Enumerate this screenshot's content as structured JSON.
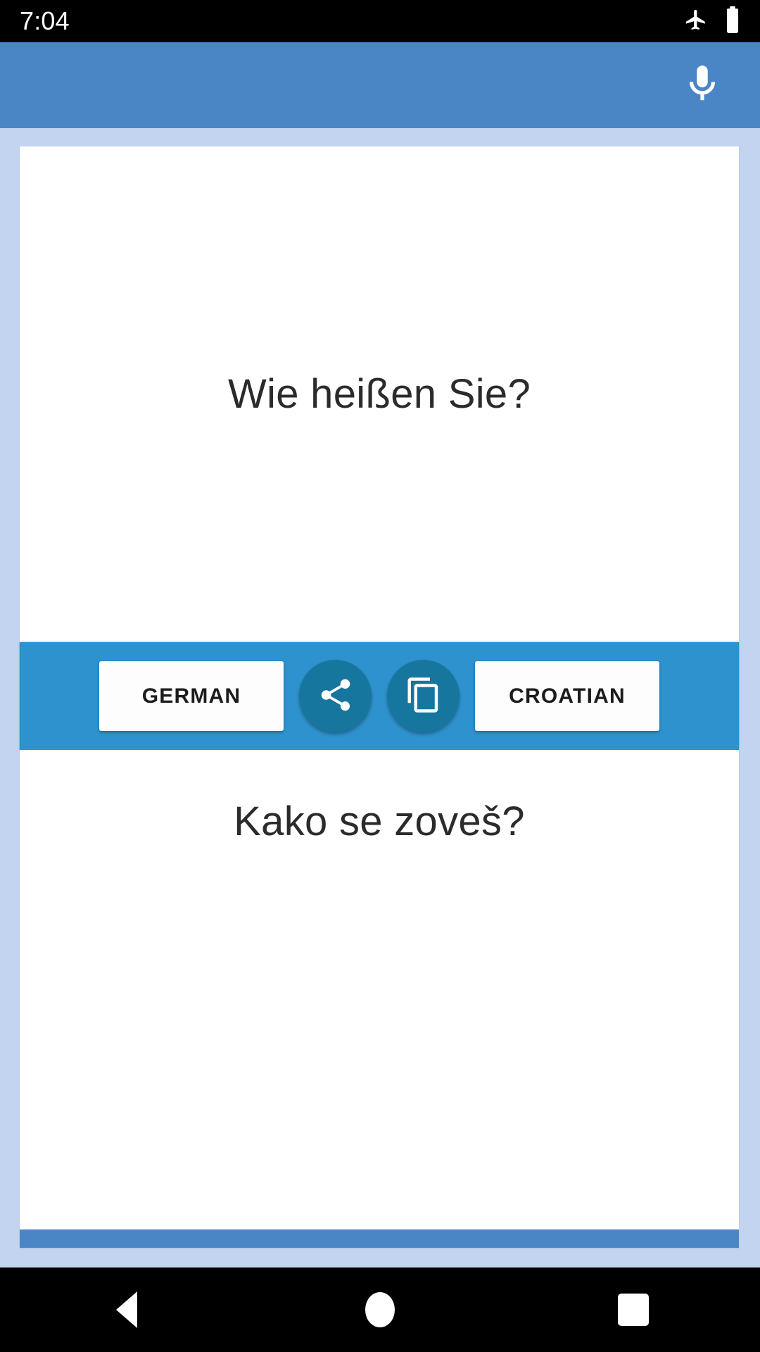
{
  "status_bar": {
    "clock": "7:04",
    "icons": [
      "airplane-mode-icon",
      "battery-icon"
    ]
  },
  "app_bar": {
    "mic_icon": "microphone-icon",
    "background_color": "#4a85c6"
  },
  "translator": {
    "source": {
      "text": "Wie heißen Sie?",
      "language_label": "GERMAN"
    },
    "target": {
      "text": "Kako se zoveš?",
      "language_label": "CROATIAN"
    },
    "toolbar": {
      "share_icon": "share-icon",
      "copy_icon": "copy-icon",
      "background_color": "#2e92ce",
      "fab_color": "#17769e"
    }
  },
  "theme": {
    "page_background": "#c3d4f0",
    "card_background": "#ffffff",
    "accent_bar_color": "#4a85c6",
    "text_color": "#2b2b2b"
  },
  "nav_bar": {
    "back_label": "back-button",
    "home_label": "home-button",
    "recents_label": "recents-button"
  }
}
